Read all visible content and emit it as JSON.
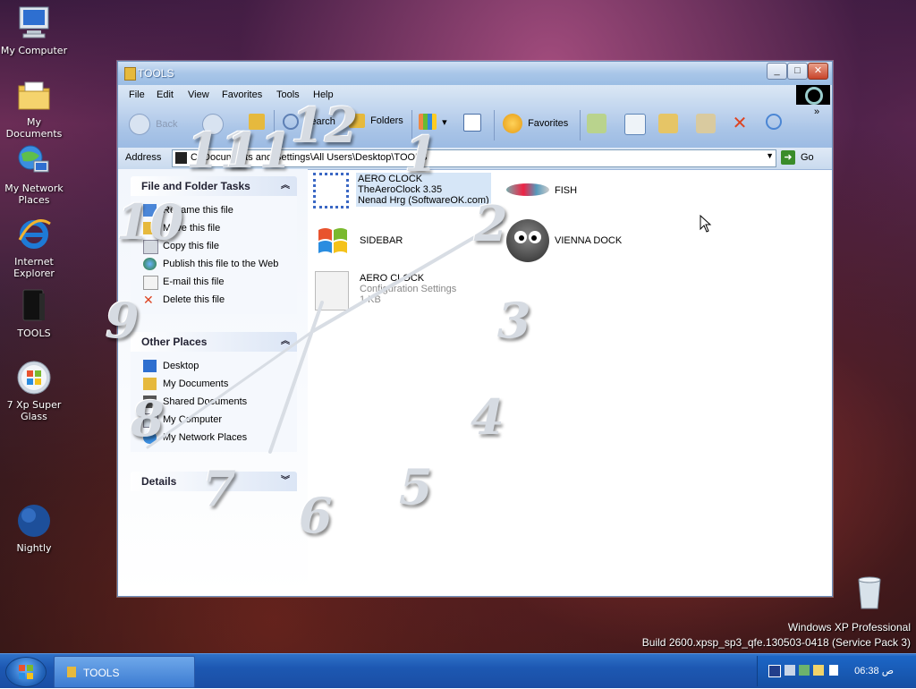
{
  "desktop": {
    "icons": [
      {
        "label": "My Computer"
      },
      {
        "label": "My Documents"
      },
      {
        "label": "My Network Places"
      },
      {
        "label": "Internet Explorer"
      },
      {
        "label": "TOOLS"
      },
      {
        "label": "7 Xp Super Glass"
      },
      {
        "label": "Nightly"
      }
    ],
    "recycle_bin": "Recycle Bin",
    "watermark_line1": "Windows XP Professional",
    "watermark_line2": "Build 2600.xpsp_sp3_qfe.130503-0418 (Service Pack 3)"
  },
  "window": {
    "title": "TOOLS",
    "menu": [
      "File",
      "Edit",
      "View",
      "Favorites",
      "Tools",
      "Help"
    ],
    "toolbar": {
      "back": "Back",
      "search": "Search",
      "folders": "Folders",
      "favorites": "Favorites"
    },
    "address": {
      "label": "Address",
      "value": "C:\\Documents and Settings\\All Users\\Desktop\\TOOLS",
      "go": "Go"
    },
    "file_tasks": {
      "title": "File and Folder Tasks",
      "items": [
        "Rename this file",
        "Move this file",
        "Copy this file",
        "Publish this file to the Web",
        "E-mail this file",
        "Delete this file"
      ]
    },
    "other_places": {
      "title": "Other Places",
      "items": [
        "Desktop",
        "My Documents",
        "Shared Documents",
        "My Computer",
        "My Network Places"
      ]
    },
    "details": {
      "title": "Details"
    },
    "files": [
      {
        "name": "AERO CLOCK",
        "line2": "TheAeroClock 3.35",
        "line3": "Nenad Hrg (SoftwareOK.com)"
      },
      {
        "name": "FISH"
      },
      {
        "name": "SIDEBAR"
      },
      {
        "name": "VIENNA DOCK"
      },
      {
        "name": "AERO CLOCK",
        "line2": "Configuration Settings",
        "line3": "1 KB"
      }
    ]
  },
  "clock_overlay": {
    "numbers": [
      "12",
      "1",
      "2",
      "3",
      "4",
      "5",
      "6",
      "7",
      "8",
      "9",
      "10",
      "11",
      "11"
    ]
  },
  "taskbar": {
    "button": "TOOLS",
    "time": "06:38 ص"
  },
  "colors": {
    "taskbar": "#1d58b2",
    "window_frame": "#a9c6e8",
    "close_button": "#c8442a"
  }
}
